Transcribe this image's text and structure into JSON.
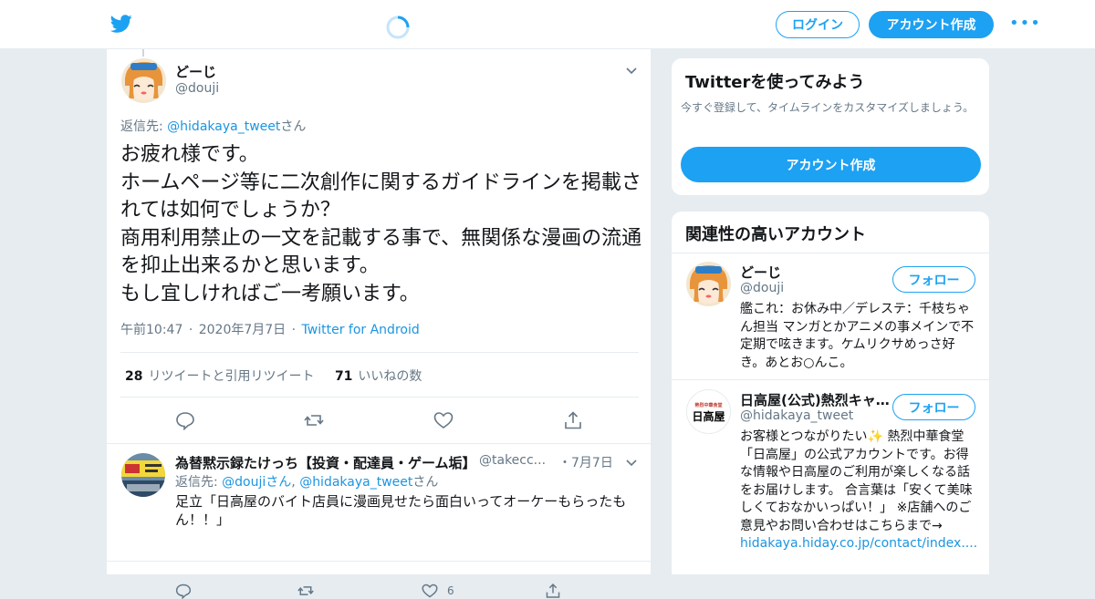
{
  "header": {
    "login_label": "ログイン",
    "signup_label": "アカウント作成",
    "more_label": "•••"
  },
  "tweet": {
    "display_name": "どーじ",
    "handle": "@douji",
    "reply_prefix": "返信先: ",
    "reply_to": "@hidakaya_tweet",
    "reply_suffix": "さん",
    "text": "お疲れ様です。\nホームページ等に二次創作に関するガイドラインを掲載されては如何でしょうか？\n商用利用禁止の一文を記載する事で、無関係な漫画の流通を抑止出来るかと思います。\nもし宜しければご一考願います。",
    "time": "午前10:47",
    "date": "2020年7月7日",
    "source": "Twitter for Android",
    "dot": "·",
    "retweet_count": "28",
    "retweet_label": "リツイートと引用リツイート",
    "like_count": "71",
    "like_label": "いいねの数"
  },
  "reply": {
    "display_name": "為替黙示録たけっち【投資・配達員・ゲーム垢】",
    "handle": "@takecc...",
    "date": "・7月7日",
    "reply_prefix": "返信先: ",
    "reply_to_1": "@doujiさん",
    "reply_sep": ", ",
    "reply_to_2": "@hidakaya_tweet",
    "reply_suffix": "さん",
    "text": "足立「日高屋のバイト店員に漫画見せたら面白いってオーケーもらったもん！！」",
    "like_count": "6"
  },
  "signup_card": {
    "title": "Twitterを使ってみよう",
    "description": "今すぐ登録して、タイムラインをカスタマイズしましょう。",
    "button_label": "アカウント作成"
  },
  "related": {
    "title": "関連性の高いアカウント",
    "accounts": [
      {
        "name": "どーじ",
        "handle": "@douji",
        "follow_label": "フォロー",
        "bio": "艦これ：お休み中／デレステ：千枝ちゃん担当 マンガとかアニメの事メインで不定期で呟きます。ケムリクサめっさ好き。あとお○んこ。"
      },
      {
        "name": "日高屋(公式)熱烈キャ...",
        "handle": "@hidakaya_tweet",
        "follow_label": "フォロー",
        "bio_1": "お客様とつながりたい",
        "sparkle": "✨",
        "bio_2": " 熱烈中華食堂「日高屋」の公式アカウントです。お得な情報や日高屋のご利用が楽しくなる話をお届けします。 合言葉は「安くて美味しくておなかいっぱい！」 ※店舗へのご意見やお問い合わせはこちらまで→",
        "link": "hidakaya.hiday.co.jp/contact/index....",
        "avatar_text_top": "熱烈中華食堂",
        "avatar_text_main": "日高屋"
      }
    ]
  },
  "colors": {
    "brand": "#1da1f2",
    "link": "#1b95e0",
    "muted": "#657786",
    "background": "#e6ecf0"
  },
  "icons": [
    "twitter-bird-icon",
    "loading-spinner-icon",
    "more-dots-icon",
    "chevron-down-icon",
    "reply-icon",
    "retweet-icon",
    "like-icon",
    "share-icon"
  ]
}
